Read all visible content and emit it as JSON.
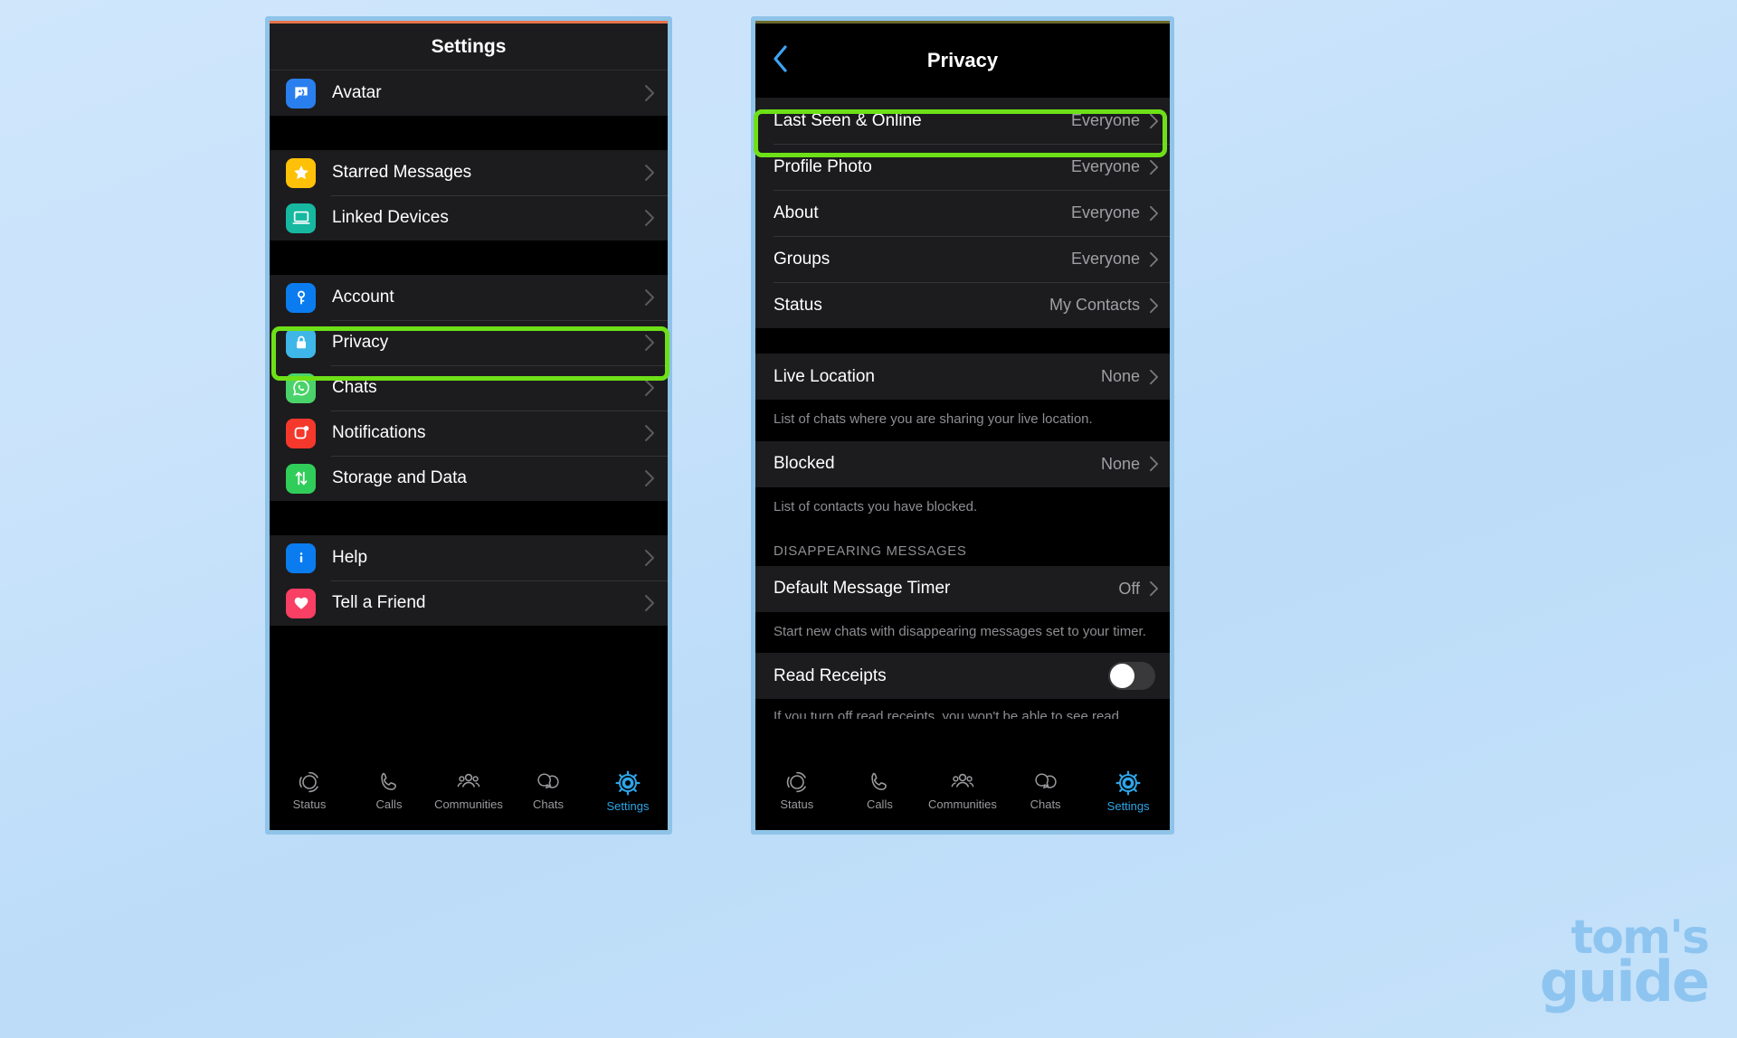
{
  "theme": {
    "accent_blue": "#2da5e8",
    "highlight_green": "#6ee017",
    "bg_page": "#c9e3fb",
    "row_bg": "#1c1c1e",
    "text_secondary": "#8e8e93"
  },
  "left_phone": {
    "nav_title": "Settings",
    "groups": [
      {
        "items": [
          {
            "label": "Avatar",
            "icon": "avatar-icon",
            "icon_class": "bg-avatar"
          }
        ]
      },
      {
        "items": [
          {
            "label": "Starred Messages",
            "icon": "star-icon",
            "icon_class": "bg-star"
          },
          {
            "label": "Linked Devices",
            "icon": "laptop-icon",
            "icon_class": "bg-device"
          }
        ]
      },
      {
        "items": [
          {
            "label": "Account",
            "icon": "key-icon",
            "icon_class": "bg-key"
          },
          {
            "label": "Privacy",
            "icon": "lock-icon",
            "icon_class": "bg-lock"
          },
          {
            "label": "Chats",
            "icon": "whatsapp-icon",
            "icon_class": "bg-chats"
          },
          {
            "label": "Notifications",
            "icon": "notification-icon",
            "icon_class": "bg-notif"
          },
          {
            "label": "Storage and Data",
            "icon": "arrows-updown-icon",
            "icon_class": "bg-store"
          }
        ]
      },
      {
        "items": [
          {
            "label": "Help",
            "icon": "info-icon",
            "icon_class": "bg-help"
          },
          {
            "label": "Tell a Friend",
            "icon": "heart-icon",
            "icon_class": "bg-heart"
          }
        ]
      }
    ],
    "tabs": [
      {
        "label": "Status",
        "icon": "status-ring-icon",
        "active": false
      },
      {
        "label": "Calls",
        "icon": "phone-icon",
        "active": false
      },
      {
        "label": "Communities",
        "icon": "people-icon",
        "active": false
      },
      {
        "label": "Chats",
        "icon": "chat-bubbles-icon",
        "active": false
      },
      {
        "label": "Settings",
        "icon": "gear-icon",
        "active": true
      }
    ]
  },
  "right_phone": {
    "nav_title": "Privacy",
    "back_icon": "chevron-left-icon",
    "rows": [
      {
        "label": "Last Seen & Online",
        "value": "Everyone"
      },
      {
        "label": "Profile Photo",
        "value": "Everyone"
      },
      {
        "label": "About",
        "value": "Everyone"
      },
      {
        "label": "Groups",
        "value": "Everyone"
      },
      {
        "label": "Status",
        "value": "My Contacts"
      }
    ],
    "live_location": {
      "label": "Live Location",
      "value": "None",
      "description": "List of chats where you are sharing your live location."
    },
    "blocked": {
      "label": "Blocked",
      "value": "None",
      "description": "List of contacts you have blocked."
    },
    "disappearing_caption": "DISAPPEARING MESSAGES",
    "default_timer": {
      "label": "Default Message Timer",
      "value": "Off",
      "description": "Start new chats with disappearing messages set to your timer."
    },
    "read_receipts": {
      "label": "Read Receipts",
      "toggle_on": false,
      "description": "If you turn off read receipts, you won't be able to see read"
    },
    "tabs": [
      {
        "label": "Status",
        "icon": "status-ring-icon",
        "active": false
      },
      {
        "label": "Calls",
        "icon": "phone-icon",
        "active": false
      },
      {
        "label": "Communities",
        "icon": "people-icon",
        "active": false
      },
      {
        "label": "Chats",
        "icon": "chat-bubbles-icon",
        "active": false
      },
      {
        "label": "Settings",
        "icon": "gear-icon",
        "active": true
      }
    ]
  },
  "watermark": {
    "line1": "tom's",
    "line2": "guide"
  }
}
